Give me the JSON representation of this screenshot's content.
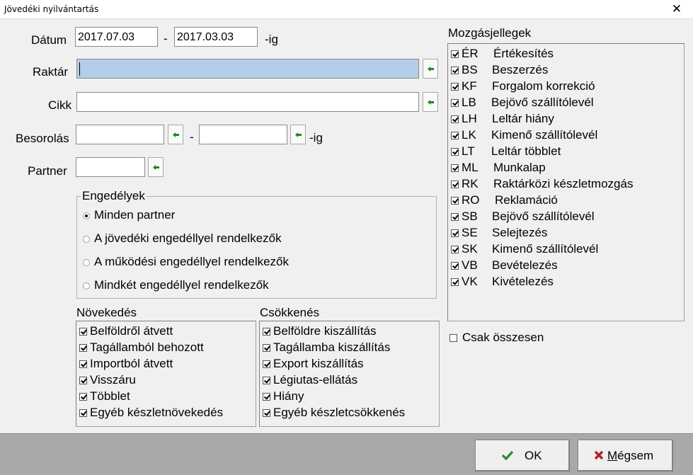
{
  "window": {
    "title": "Jövedéki nyilvántartás",
    "close_glyph": "✕"
  },
  "filters": {
    "datum_label": "Dátum",
    "date_from": "2017.07.03",
    "date_sep": "-",
    "date_to": "2017.03.03",
    "date_suffix": "-ig",
    "raktar_label": "Raktár",
    "raktar_value": "",
    "cikk_label": "Cikk",
    "cikk_value": "",
    "besorolas_label": "Besorolás",
    "besorolas_from": "",
    "besorolas_sep": "-",
    "besorolas_to": "",
    "besorolas_suffix": "-ig",
    "partner_label": "Partner",
    "partner_value": ""
  },
  "engedelyek": {
    "title": "Engedélyek",
    "options": [
      {
        "label": "Minden partner",
        "selected": true
      },
      {
        "label": "A jövedéki engedéllyel rendelkezők",
        "selected": false
      },
      {
        "label": "A működési engedéllyel rendelkezők",
        "selected": false
      },
      {
        "label": "Mindkét engedéllyel rendelkezők",
        "selected": false
      }
    ]
  },
  "novekedes": {
    "title": "Növekedés",
    "items": [
      {
        "label": "Belföldről átvett",
        "checked": true
      },
      {
        "label": "Tagállamból behozott",
        "checked": true
      },
      {
        "label": "Importból átvett",
        "checked": true
      },
      {
        "label": "Visszáru",
        "checked": true
      },
      {
        "label": "Többlet",
        "checked": true
      },
      {
        "label": "Egyéb készletnövekedés",
        "checked": true
      }
    ]
  },
  "csokkenes": {
    "title": "Csökkenés",
    "items": [
      {
        "label": "Belföldre kiszállítás",
        "checked": true
      },
      {
        "label": "Tagállamba kiszállítás",
        "checked": true
      },
      {
        "label": "Export kiszállítás",
        "checked": true
      },
      {
        "label": "Légiutas-ellátás",
        "checked": true
      },
      {
        "label": "Hiány",
        "checked": true
      },
      {
        "label": "Egyéb készletcsökkenés",
        "checked": true
      }
    ]
  },
  "mozgasjellegek": {
    "title": "Mozgásjellegek",
    "items": [
      {
        "code": "ÉR",
        "name": "Értékesítés",
        "checked": true
      },
      {
        "code": "BS",
        "name": "Beszerzés",
        "checked": true
      },
      {
        "code": "KF",
        "name": "Forgalom korrekció",
        "checked": true
      },
      {
        "code": "LB",
        "name": "Bejövő szállítólevél",
        "checked": true
      },
      {
        "code": "LH",
        "name": "Leltár hiány",
        "checked": true
      },
      {
        "code": "LK",
        "name": "Kimenő szállítólevél",
        "checked": true
      },
      {
        "code": "LT",
        "name": "Leltár többlet",
        "checked": true
      },
      {
        "code": "ML",
        "name": "Munkalap",
        "checked": true
      },
      {
        "code": "RK",
        "name": "Raktárközi készletmozgás",
        "checked": true
      },
      {
        "code": "RO",
        "name": "Reklamáció",
        "checked": true
      },
      {
        "code": "SB",
        "name": "Bejövő szállítólevél",
        "checked": true
      },
      {
        "code": "SE",
        "name": "Selejtezés",
        "checked": true
      },
      {
        "code": "SK",
        "name": "Kimenő szállítólevél",
        "checked": true
      },
      {
        "code": "VB",
        "name": "Bevételezés",
        "checked": true
      },
      {
        "code": "VK",
        "name": "Kivételezés",
        "checked": true
      }
    ]
  },
  "csak_osszesen": {
    "label": "Csak összesen",
    "checked": false
  },
  "buttons": {
    "ok_label": "OK",
    "cancel_mnemonic": "M",
    "cancel_rest": "égsem"
  },
  "colors": {
    "highlight_field": "#b4cde8",
    "ok_check": "#2e8b2e",
    "cancel_x": "#b22222",
    "picker_arrow": "#1a8a1a"
  }
}
